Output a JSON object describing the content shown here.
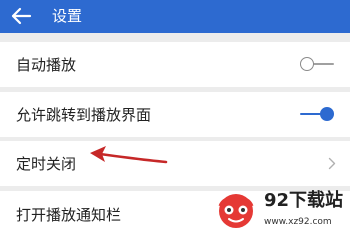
{
  "header": {
    "title": "设置",
    "back_icon": "back-arrow-icon"
  },
  "settings": [
    {
      "label": "自动播放",
      "control": "toggle",
      "state": "off"
    },
    {
      "label": "允许跳转到播放界面",
      "control": "toggle",
      "state": "on"
    },
    {
      "label": "定时关闭",
      "control": "chevron",
      "icon": "chevron-right-icon"
    },
    {
      "label": "打开播放通知栏",
      "control": "none"
    }
  ],
  "annotation": {
    "icon": "red-arrow-icon"
  },
  "watermark": {
    "title": "92下载站",
    "url": "www.xz92.com"
  },
  "colors": {
    "accent": "#2d6ad0",
    "background": "#ececec",
    "row": "#ffffff",
    "annotation": "#c62828"
  }
}
